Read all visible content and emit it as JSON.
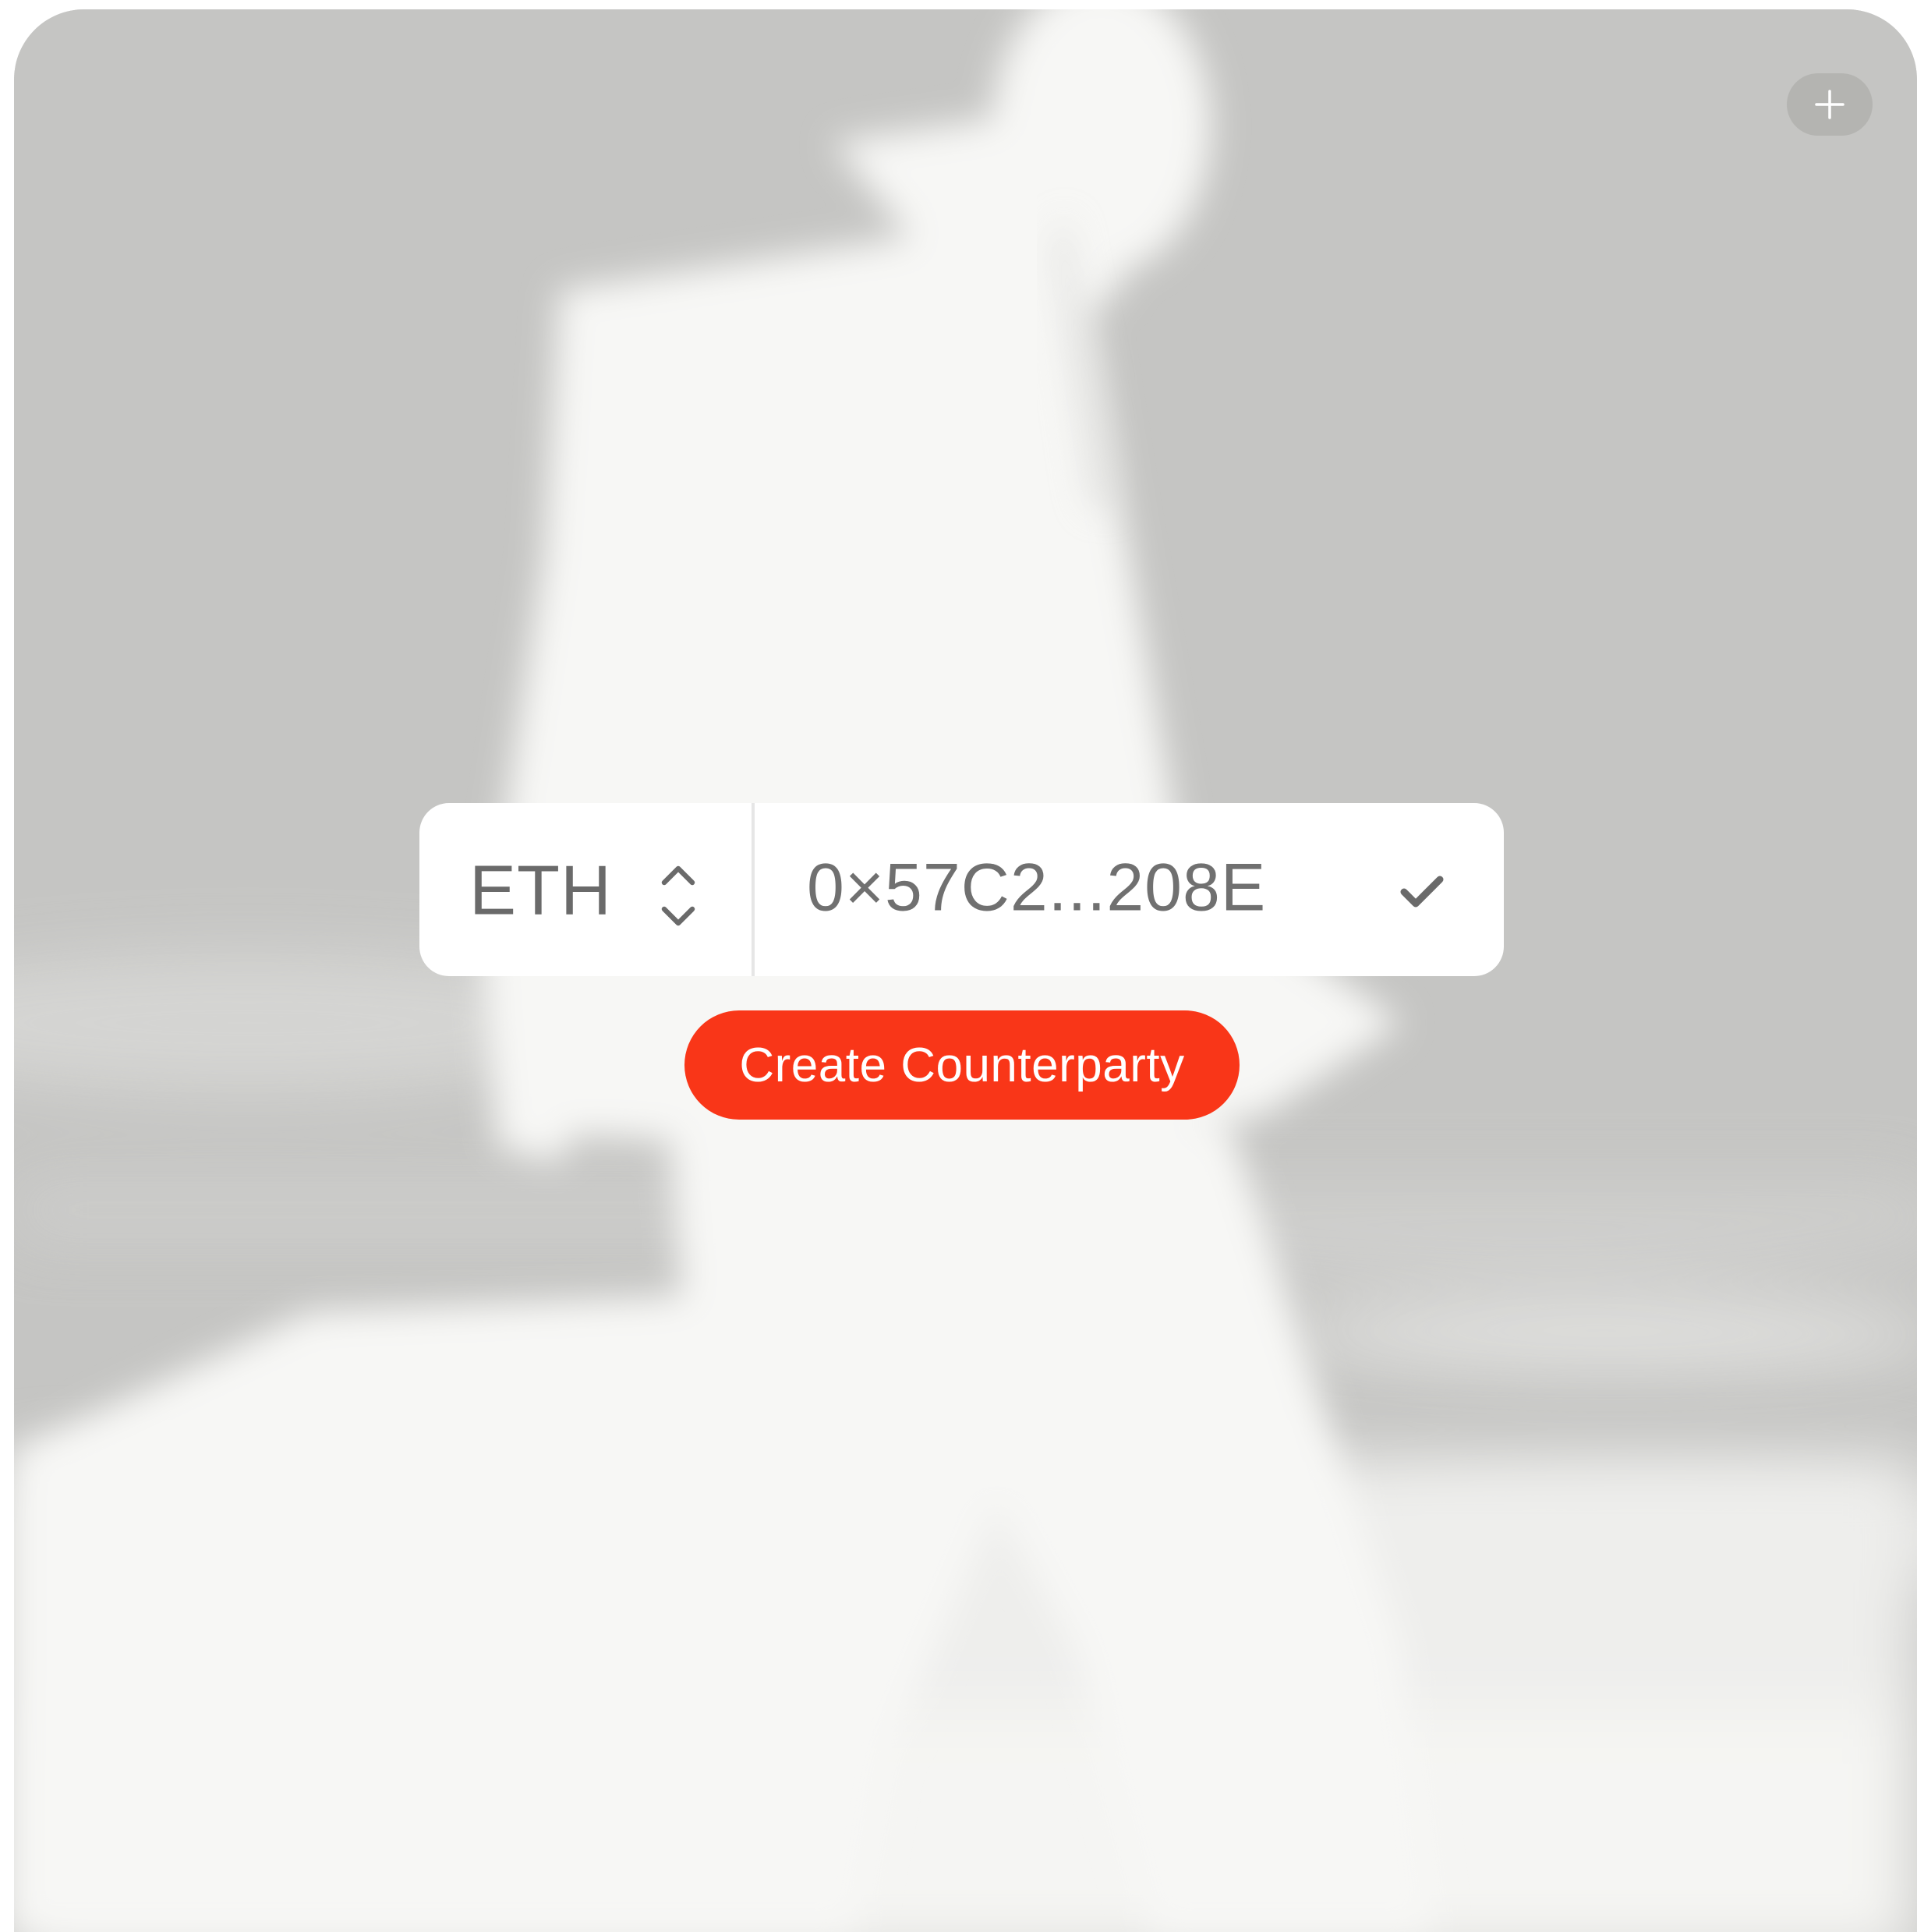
{
  "form": {
    "chain_value": "ETH",
    "address_value": "0×57C2...208E",
    "create_label": "Create Counterparty"
  },
  "icons": {
    "add": "plus-icon",
    "chain_toggle": "chevron-up-down-icon",
    "valid": "checkmark-icon"
  },
  "colors": {
    "accent": "#f93618",
    "background": "#c5c5c3",
    "field": "#ffffff",
    "text_muted": "#6a6a6a"
  }
}
